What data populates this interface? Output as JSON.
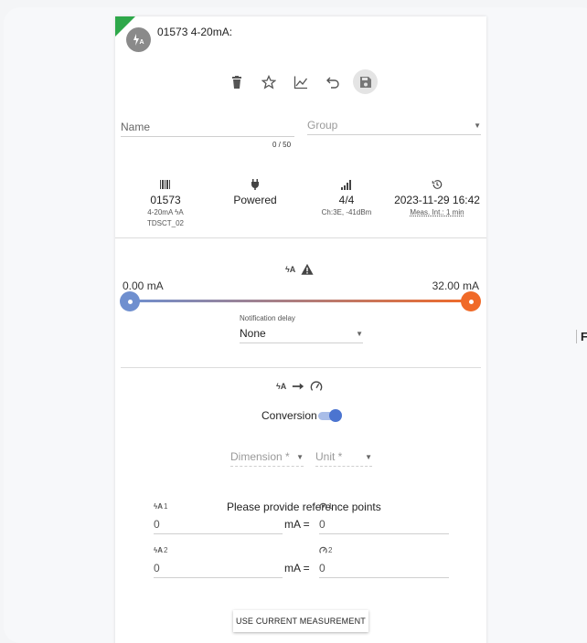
{
  "device": {
    "title": "01573 4-20mA:",
    "avatar_icon": "current-sensor-icon"
  },
  "toolbar": {
    "icons": [
      "delete-icon",
      "star-icon",
      "chart-icon",
      "undo-icon",
      "save-icon"
    ]
  },
  "form": {
    "name_placeholder": "Name",
    "name_value": "",
    "name_counter": "0 / 50",
    "group_placeholder": "Group"
  },
  "info": {
    "id": "01573",
    "type": "4-20mA",
    "model": "TDSCT_02",
    "power": "Powered",
    "signal": "4/4",
    "signal_detail": "Ch:3E, -41dBm",
    "timestamp": "2023-11-29 16:42",
    "interval": "Meas. Int.: 1 min"
  },
  "alarm": {
    "min_label": "0.00 mA",
    "max_label": "32.00 mA",
    "notification_label": "Notification delay",
    "notification_value": "None",
    "cropped_text": "F"
  },
  "conversion": {
    "label": "Conversion",
    "enabled": true,
    "dimension_placeholder": "Dimension *",
    "unit_placeholder": "Unit *",
    "reference_title": "Please provide reference points",
    "point1_input_label": "1",
    "point1_output_label": "1",
    "point2_input_label": "2",
    "point2_output_label": "2",
    "point1_input": "0",
    "point1_output": "0",
    "point2_input": "0",
    "point2_output": "0",
    "unit_eq": "mA =",
    "use_current_label": "USE CURRENT MEASUREMENT"
  },
  "colors": {
    "accent_blue": "#4b74d0",
    "range_low": "#6f8fcf",
    "range_high": "#f06a28",
    "status_green": "#2ea84a"
  }
}
